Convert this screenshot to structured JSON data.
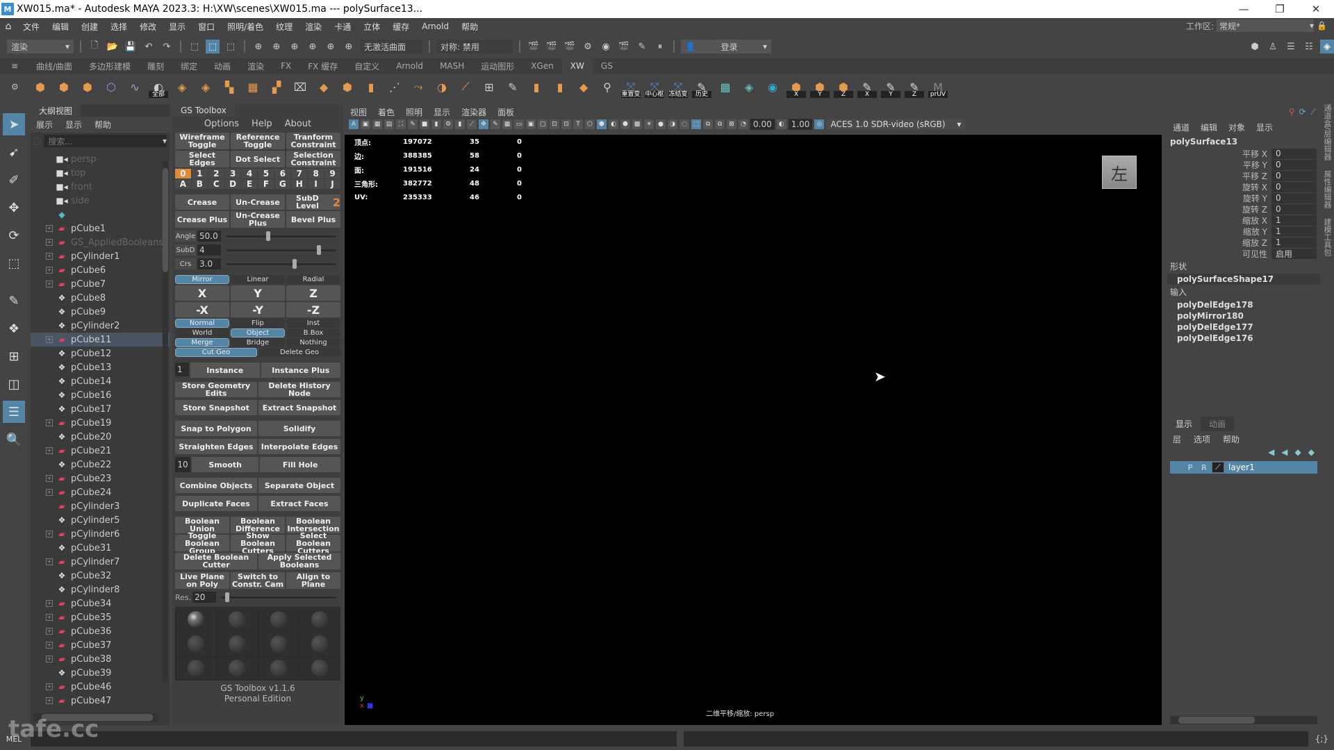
{
  "window": {
    "title": "XW015.ma* - Autodesk MAYA 2023.3: H:\\XW\\scenes\\XW015.ma   ---   polySurface13...",
    "app_icon": "maya-logo",
    "minimize": "—",
    "maximize": "❐",
    "close": "✕"
  },
  "menubar": {
    "items": [
      "文件",
      "编辑",
      "创建",
      "选择",
      "修改",
      "显示",
      "窗口",
      "照明/着色",
      "纹理",
      "渲染",
      "卡通",
      "立体",
      "缓存",
      "Arnold",
      "帮助"
    ],
    "workspace_label": "工作区:",
    "workspace_value": "常规*"
  },
  "statusline": {
    "menuset": "渲染",
    "live_surface": "无激活曲面",
    "symmetry": "对称: 禁用",
    "login": "登录"
  },
  "shelf": {
    "tabs": [
      "曲线/曲面",
      "多边形建模",
      "雕刻",
      "绑定",
      "动画",
      "渲染",
      "FX",
      "FX 缓存",
      "自定义",
      "Arnold",
      "MASH",
      "运动图形",
      "XGen",
      "XW",
      "GS"
    ],
    "active_tab": "XW",
    "labeled_buttons": [
      "全部",
      "重置变",
      "中心枢",
      "冻结变",
      "历史",
      "X",
      "Y",
      "Z",
      "X",
      "Y",
      "Z",
      "prUV"
    ]
  },
  "outliner": {
    "tab": "大纲视图",
    "menu": [
      "展示",
      "显示",
      "帮助"
    ],
    "search_placeholder": "搜索...",
    "items": [
      {
        "name": "persp",
        "type": "camera",
        "expand": false,
        "dim": true
      },
      {
        "name": "top",
        "type": "camera",
        "expand": false,
        "dim": true
      },
      {
        "name": "front",
        "type": "camera",
        "expand": false,
        "dim": true
      },
      {
        "name": "side",
        "type": "camera",
        "expand": false,
        "dim": true
      },
      {
        "name": "",
        "type": "set",
        "expand": false,
        "dim": true
      },
      {
        "name": "pCube1",
        "type": "mesh",
        "expand": true
      },
      {
        "name": "GS_AppliedBooleans",
        "type": "mesh",
        "expand": true,
        "dim": true
      },
      {
        "name": "pCylinder1",
        "type": "mesh",
        "expand": true
      },
      {
        "name": "pCube6",
        "type": "mesh",
        "expand": true
      },
      {
        "name": "pCube7",
        "type": "mesh",
        "expand": true
      },
      {
        "name": "pCube8",
        "type": "group",
        "expand": false
      },
      {
        "name": "pCube9",
        "type": "group",
        "expand": false
      },
      {
        "name": "pCylinder2",
        "type": "group",
        "expand": false
      },
      {
        "name": "pCube11",
        "type": "mesh",
        "expand": true,
        "selected": true
      },
      {
        "name": "pCube12",
        "type": "group",
        "expand": false
      },
      {
        "name": "pCube13",
        "type": "group",
        "expand": false
      },
      {
        "name": "pCube14",
        "type": "group",
        "expand": false
      },
      {
        "name": "pCube16",
        "type": "group",
        "expand": false
      },
      {
        "name": "pCube17",
        "type": "group",
        "expand": false
      },
      {
        "name": "pCube19",
        "type": "mesh",
        "expand": true
      },
      {
        "name": "pCube20",
        "type": "group",
        "expand": false
      },
      {
        "name": "pCube21",
        "type": "mesh",
        "expand": true
      },
      {
        "name": "pCube22",
        "type": "group",
        "expand": false
      },
      {
        "name": "pCube23",
        "type": "mesh",
        "expand": true
      },
      {
        "name": "pCube24",
        "type": "mesh",
        "expand": true
      },
      {
        "name": "pCylinder3",
        "type": "mesh",
        "expand": false
      },
      {
        "name": "pCylinder5",
        "type": "group",
        "expand": false
      },
      {
        "name": "pCylinder6",
        "type": "mesh",
        "expand": true
      },
      {
        "name": "pCube31",
        "type": "group",
        "expand": false
      },
      {
        "name": "pCylinder7",
        "type": "mesh",
        "expand": true
      },
      {
        "name": "pCube32",
        "type": "group",
        "expand": false
      },
      {
        "name": "pCylinder8",
        "type": "group",
        "expand": false
      },
      {
        "name": "pCube34",
        "type": "mesh",
        "expand": true
      },
      {
        "name": "pCube35",
        "type": "mesh",
        "expand": true
      },
      {
        "name": "pCube36",
        "type": "mesh",
        "expand": true
      },
      {
        "name": "pCube37",
        "type": "mesh",
        "expand": true
      },
      {
        "name": "pCube38",
        "type": "mesh",
        "expand": true
      },
      {
        "name": "pCube39",
        "type": "group",
        "expand": false
      },
      {
        "name": "pCube46",
        "type": "mesh",
        "expand": true
      },
      {
        "name": "pCube47",
        "type": "mesh",
        "expand": true
      }
    ]
  },
  "gstoolbox": {
    "tab": "GS Toolbox",
    "menu": [
      "Options",
      "Help",
      "About"
    ],
    "row1": [
      "Wireframe Toggle",
      "Reference Toggle",
      "Tranform Constraint"
    ],
    "row2": [
      "Select Edges",
      "Dot Select",
      "Selection Constraint"
    ],
    "numbers": [
      "0",
      "1",
      "2",
      "3",
      "4",
      "5",
      "6",
      "7",
      "8",
      "9"
    ],
    "letters": [
      "A",
      "B",
      "C",
      "D",
      "E",
      "F",
      "G",
      "H",
      "I",
      "J"
    ],
    "active_number": "0",
    "crease_row": [
      "Crease",
      "Un-Crease",
      "SubD Level"
    ],
    "subd_level": "2",
    "crease_plus_row": [
      "Crease Plus",
      "Un-Crease Plus",
      "Bevel Plus"
    ],
    "sliders": [
      {
        "label": "Angle",
        "value": "50.0",
        "fraction": 0.36
      },
      {
        "label": "SubD",
        "value": "4",
        "fraction": 0.82
      },
      {
        "label": "Crs",
        "value": "3.0",
        "fraction": 0.6
      }
    ],
    "mirror_modes": [
      "Mirror",
      "Linear",
      "Radial"
    ],
    "axes_pos": [
      "X",
      "Y",
      "Z"
    ],
    "axes_neg": [
      "-X",
      "-Y",
      "-Z"
    ],
    "opt_row1": [
      "Normal",
      "Flip",
      "Inst"
    ],
    "opt_row2": [
      "World",
      "Object",
      "B.Box"
    ],
    "opt_row3": [
      "Merge",
      "Bridge",
      "Nothing"
    ],
    "opt_row4": [
      "Cut Geo",
      "Delete Geo"
    ],
    "instance_count": "1",
    "instance": [
      "Instance",
      "Instance Plus"
    ],
    "geo_edits": [
      "Store Geometry Edits",
      "Delete History Node"
    ],
    "snapshot": [
      "Store Snapshot",
      "Extract Snapshot"
    ],
    "snap": [
      "Snap to Polygon",
      "Solidify"
    ],
    "edges": [
      "Straighten Edges",
      "Interpolate Edges"
    ],
    "smooth_count": "10",
    "smooth": [
      "Smooth",
      "Fill Hole"
    ],
    "combine": [
      "Combine Objects",
      "Separate Object"
    ],
    "faces": [
      "Duplicate Faces",
      "Extract Faces"
    ],
    "boolean1": [
      "Boolean Union",
      "Boolean Difference",
      "Boolean Intersection"
    ],
    "boolean2": [
      "Toggle Boolean Group",
      "Show Boolean Cutters",
      "Select Boolean Cutters"
    ],
    "boolean3": [
      "Delete Boolean Cutter",
      "Apply Selected Booleans"
    ],
    "plane": [
      "Live Plane on Poly",
      "Switch to Constr. Cam",
      "Align to Plane"
    ],
    "res_label": "Res.",
    "res_value": "20",
    "res_fraction": 0.03,
    "footer_line1": "GS Toolbox v1.1.6",
    "footer_line2": "Personal Edition"
  },
  "viewport": {
    "menu": [
      "视图",
      "着色",
      "照明",
      "显示",
      "渲染器",
      "面板"
    ],
    "exposure": "0.00",
    "gamma": "1.00",
    "color_space": "ACES 1.0 SDR-video (sRGB)",
    "hud": [
      {
        "label": "顶点:",
        "total": "197072",
        "sel": "35",
        "comp": "0"
      },
      {
        "label": "边:",
        "total": "388385",
        "sel": "58",
        "comp": "0"
      },
      {
        "label": "面:",
        "total": "191516",
        "sel": "24",
        "comp": "0"
      },
      {
        "label": "三角形:",
        "total": "382772",
        "sel": "48",
        "comp": "0"
      },
      {
        "label": "UV:",
        "total": "235333",
        "sel": "46",
        "comp": "0"
      }
    ],
    "viewcube_label": "左",
    "camera_label": "二维平移/缩放: persp",
    "axis_y": "y"
  },
  "channelbox": {
    "menu": [
      "通道",
      "编辑",
      "对象",
      "显示"
    ],
    "object": "polySurface13",
    "channels": [
      {
        "k": "平移 X",
        "v": "0"
      },
      {
        "k": "平移 Y",
        "v": "0"
      },
      {
        "k": "平移 Z",
        "v": "0"
      },
      {
        "k": "旋转 X",
        "v": "0"
      },
      {
        "k": "旋转 Y",
        "v": "0"
      },
      {
        "k": "旋转 Z",
        "v": "0"
      },
      {
        "k": "缩放 X",
        "v": "1"
      },
      {
        "k": "缩放 Y",
        "v": "1"
      },
      {
        "k": "缩放 Z",
        "v": "1"
      },
      {
        "k": "可见性",
        "v": "启用"
      }
    ],
    "shape_header": "形状",
    "shape": "polySurfaceShape17",
    "inputs_header": "输入",
    "inputs": [
      "polyDelEdge178",
      "polyMirror180",
      "polyDelEdge177",
      "polyDelEdge176"
    ],
    "side_tabs": [
      "通道盒/层编辑器",
      "属性编辑器",
      "建模工具包"
    ]
  },
  "layers": {
    "tabs": [
      "显示",
      "动画"
    ],
    "menu": [
      "层",
      "选项",
      "帮助"
    ],
    "layer": {
      "p": "P",
      "r": "R",
      "name": "layer1"
    }
  },
  "cmdline": {
    "label": "MEL"
  },
  "watermark": "tafe.cc"
}
